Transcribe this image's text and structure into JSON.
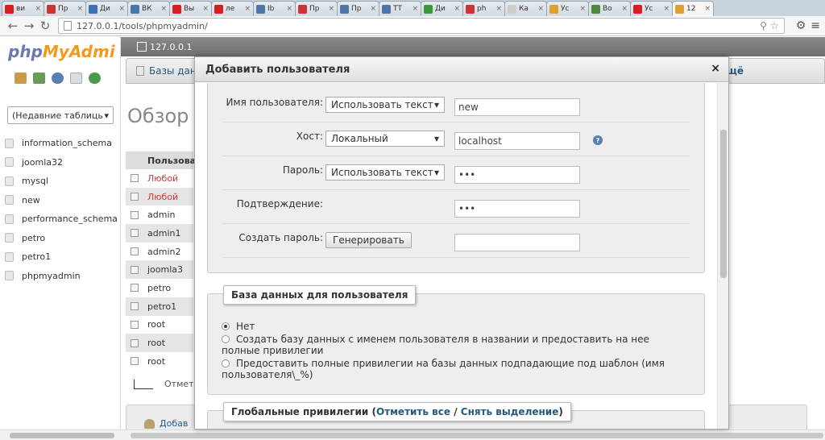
{
  "browser": {
    "tabs": [
      {
        "title": "ви",
        "icon_color": "#d61f1f"
      },
      {
        "title": "Пр",
        "icon_color": "#c33"
      },
      {
        "title": "Ди",
        "icon_color": "#3b6fb6"
      },
      {
        "title": "ВК",
        "icon_color": "#4a76a8"
      },
      {
        "title": "Вы",
        "icon_color": "#d61f1f"
      },
      {
        "title": "ле",
        "icon_color": "#d61f1f"
      },
      {
        "title": "Ib",
        "icon_color": "#4a76a8"
      },
      {
        "title": "Пр",
        "icon_color": "#c33"
      },
      {
        "title": "Пр",
        "icon_color": "#4a76a8"
      },
      {
        "title": "ТТ",
        "icon_color": "#4a76a8"
      },
      {
        "title": "Ди",
        "icon_color": "#3a9a3a"
      },
      {
        "title": "ph",
        "icon_color": "#c33"
      },
      {
        "title": "Ка",
        "icon_color": "#ccc"
      },
      {
        "title": "Ус",
        "icon_color": "#e0a030"
      },
      {
        "title": "Во",
        "icon_color": "#4a8a3a"
      },
      {
        "title": "Ус",
        "icon_color": "#d61f1f"
      },
      {
        "title": "12",
        "icon_color": "#e0a030",
        "active": true
      }
    ],
    "url": "127.0.0.1/tools/phpmyadmin/"
  },
  "sidebar": {
    "logo_php": "php",
    "logo_myadmin": "MyAdmi",
    "recent_select": "(Недавние таблиць",
    "databases": [
      "information_schema",
      "joomla32",
      "mysql",
      "new",
      "performance_schema",
      "petro",
      "petro1",
      "phpmyadmin"
    ]
  },
  "main": {
    "server": "127.0.0.1",
    "tab_label": "Базы дан",
    "right_tab": "щё",
    "overview_title": "Обзор у",
    "users_header": "Пользова",
    "users": [
      {
        "name": "Любой",
        "red": true
      },
      {
        "name": "Любой",
        "red": true
      },
      {
        "name": "admin",
        "red": false
      },
      {
        "name": "admin1",
        "red": false
      },
      {
        "name": "admin2",
        "red": false
      },
      {
        "name": "joomla3",
        "red": false
      },
      {
        "name": "petro",
        "red": false
      },
      {
        "name": "petro1",
        "red": false
      },
      {
        "name": "root",
        "red": false
      },
      {
        "name": "root",
        "red": false
      },
      {
        "name": "root",
        "red": false
      }
    ],
    "check_all": "Отмет",
    "add_user": "Добав"
  },
  "dialog": {
    "title": "Добавить пользователя",
    "close": "×",
    "username_label": "Имя пользователя:",
    "username_mode": "Использовать текст",
    "username_value": "new",
    "host_label": "Хост:",
    "host_mode": "Локальный",
    "host_value": "localhost",
    "password_label": "Пароль:",
    "password_mode": "Использовать текст",
    "password_value": "•••",
    "confirm_label": "Подтверждение:",
    "confirm_value": "•••",
    "generate_label": "Создать пароль:",
    "generate_button": "Генерировать",
    "generate_value": "",
    "db_legend": "База данных для пользователя",
    "db_options": [
      {
        "label": "Нет",
        "checked": true
      },
      {
        "label": "Создать базу данных с именем пользователя в названии и предоставить на нее полные привилегии",
        "checked": false
      },
      {
        "label": "Предоставить полные привилегии на базы данных подпадающие под шаблон (имя пользователя\\_%)",
        "checked": false
      }
    ],
    "priv_legend_prefix": "Глобальные привилегии (",
    "priv_check_all": "Отметить все",
    "priv_sep": " / ",
    "priv_uncheck_all": "Снять выделение",
    "priv_legend_suffix": ")"
  }
}
